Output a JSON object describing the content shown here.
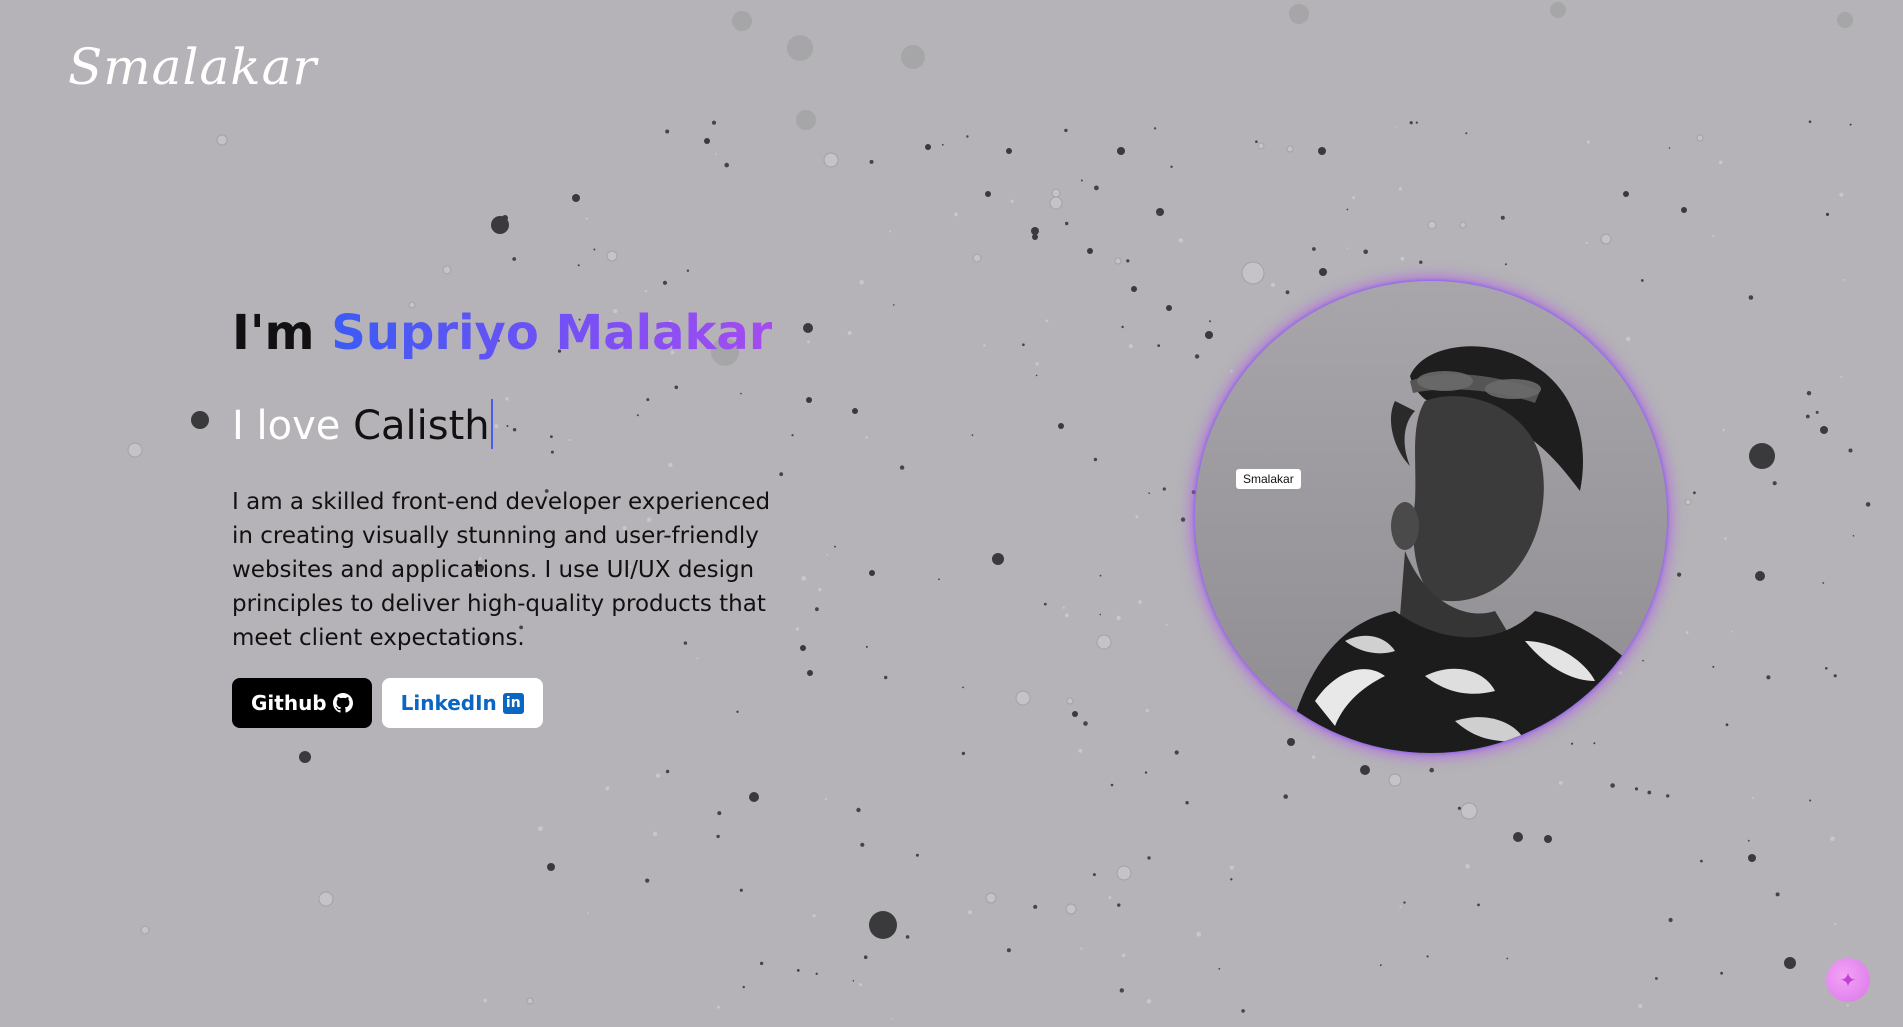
{
  "logo": {
    "text": "Smalakar"
  },
  "hero": {
    "greeting": "I'm",
    "name": "Supriyo Malakar",
    "typed_prefix": "I love",
    "typed_text": "Calisth",
    "description": "I am a skilled front-end developer experienced in creating visually stunning and user-friendly websites and applications. I use UI/UX design principles to deliver high-quality products that meet client expectations."
  },
  "buttons": {
    "github_label": "Github",
    "linkedin_label": "LinkedIn",
    "github_icon": "github-icon",
    "linkedin_icon": "linkedin-icon"
  },
  "avatar": {
    "tooltip": "Smalakar"
  },
  "fab": {
    "icon": "sparkle-icon"
  },
  "colors": {
    "background": "#b5b3b7",
    "name_gradient_start": "#3b5bf5",
    "name_gradient_end": "#a54cf0",
    "linkedin_blue": "#0a66c2",
    "avatar_glow": "#b252f0"
  }
}
